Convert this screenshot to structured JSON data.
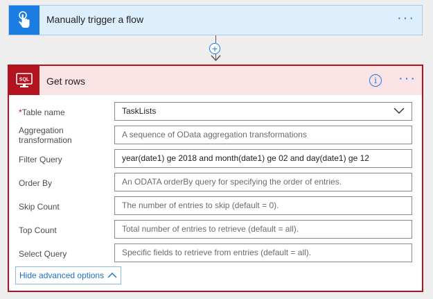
{
  "trigger": {
    "title": "Manually trigger a flow",
    "icon": "touch-hand-icon",
    "color": "#1b7ce1"
  },
  "connector": {
    "add_icon": "plus-circle-icon"
  },
  "action": {
    "title": "Get rows",
    "icon": "sql-icon",
    "icon_text": "SQL",
    "color": "#b3121f",
    "fields": [
      {
        "label": "Table name",
        "required": "*",
        "value": "TaskLists",
        "type": "dropdown"
      },
      {
        "label": "Aggregation transformation",
        "placeholder": "A sequence of OData aggregation transformations"
      },
      {
        "label": "Filter Query",
        "value": "year(date1) ge 2018 and month(date1) ge 02 and day(date1) ge 12"
      },
      {
        "label": "Order By",
        "placeholder": "An ODATA orderBy query for specifying the order of entries."
      },
      {
        "label": "Skip Count",
        "placeholder": "The number of entries to skip (default = 0)."
      },
      {
        "label": "Top Count",
        "placeholder": "Total number of entries to retrieve (default = all)."
      },
      {
        "label": "Select Query",
        "placeholder": "Specific fields to retrieve from entries (default = all)."
      }
    ],
    "advanced_label": "Hide advanced options"
  }
}
